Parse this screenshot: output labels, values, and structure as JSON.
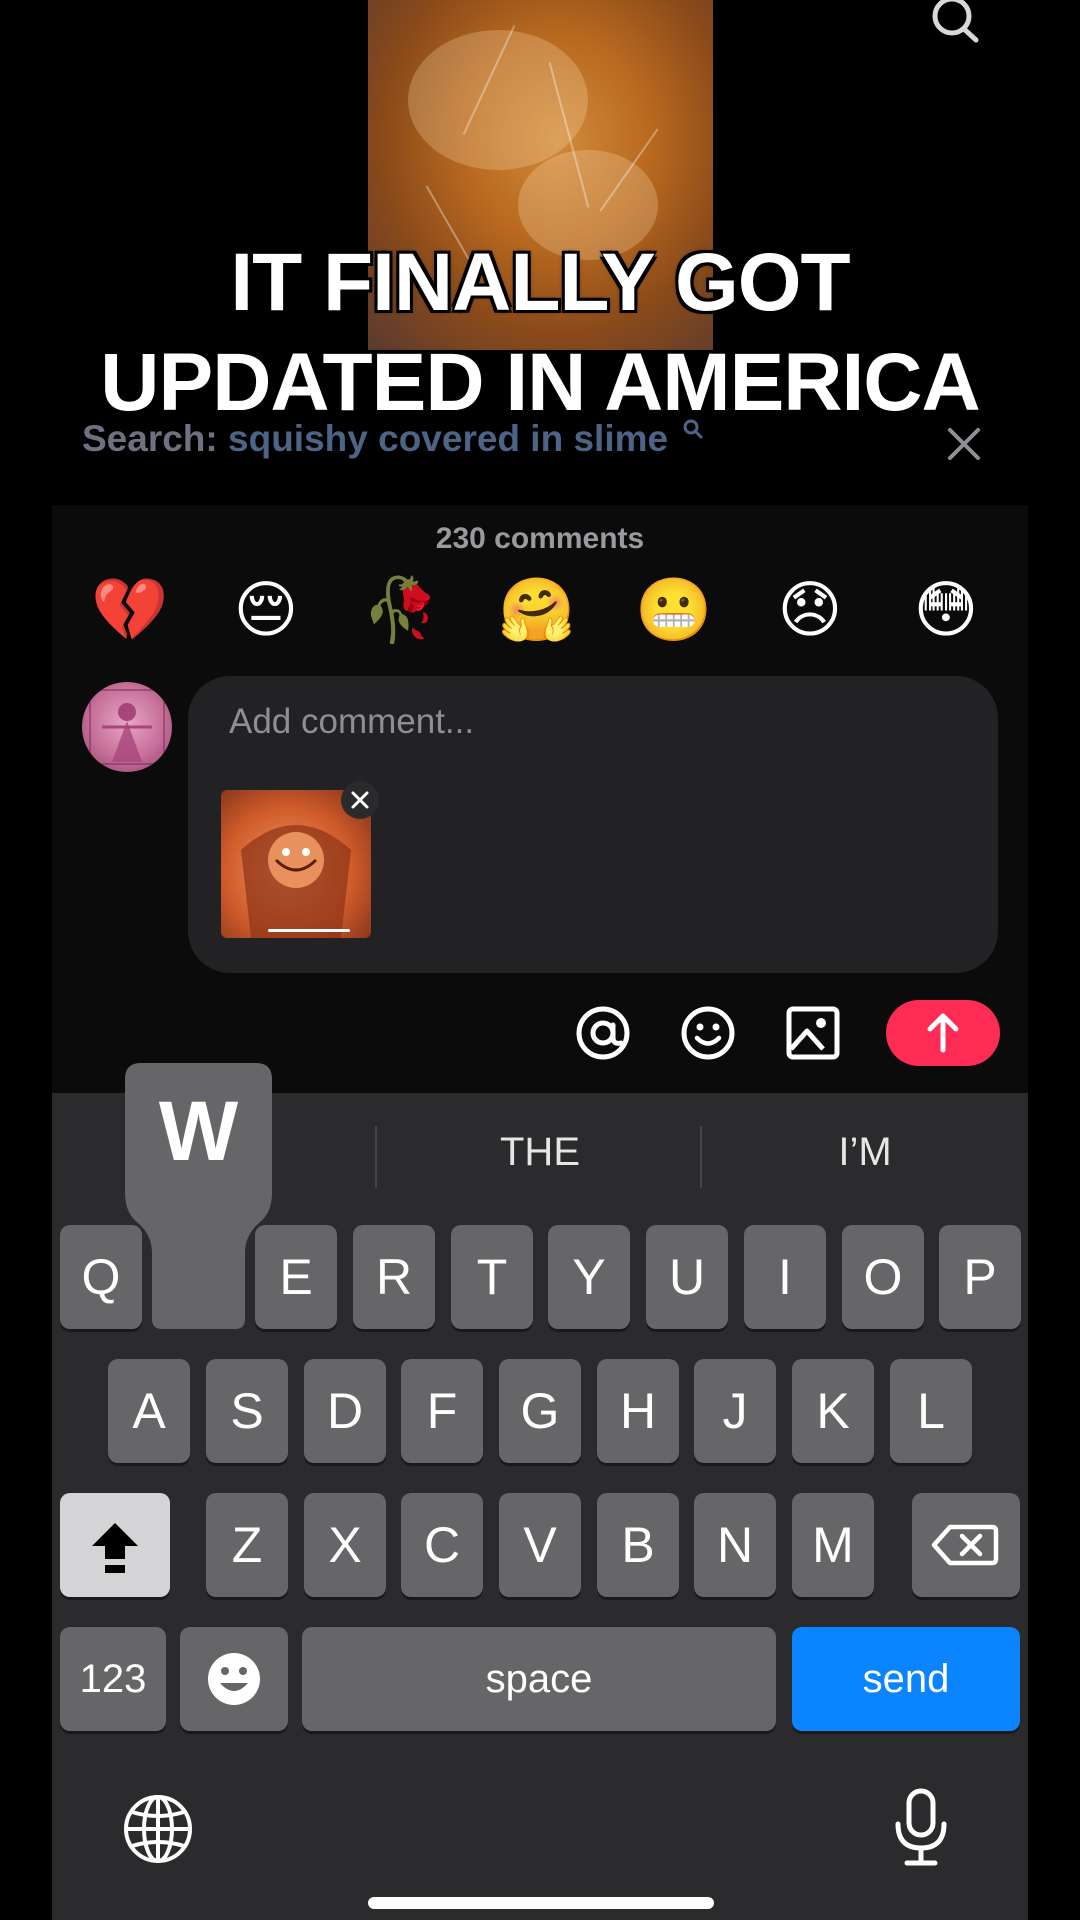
{
  "video": {
    "caption_line1": "IT FINALLY GOT",
    "caption_line2": "UPDATED IN AMERICA"
  },
  "search": {
    "prefix": "Search:",
    "query": "squishy covered in slime"
  },
  "comments": {
    "count_label": "230 comments",
    "quick_emojis": [
      "💔",
      "😔",
      "🥀",
      "🤗",
      "😬",
      "😞",
      "😳"
    ],
    "input_placeholder": "Add comment..."
  },
  "keyboard": {
    "popup_key": "W",
    "suggestions": [
      "THE",
      "I’M"
    ],
    "row1": [
      "Q",
      "W",
      "E",
      "R",
      "T",
      "Y",
      "U",
      "I",
      "O",
      "P"
    ],
    "row2": [
      "A",
      "S",
      "D",
      "F",
      "G",
      "H",
      "J",
      "K",
      "L"
    ],
    "row3": [
      "Z",
      "X",
      "C",
      "V",
      "B",
      "N",
      "M"
    ],
    "numbers_key": "123",
    "space_key": "space",
    "send_key": "send"
  },
  "colors": {
    "accent_red": "#fe2c55",
    "send_blue": "#0a84ff",
    "search_query": "#4d6487"
  },
  "icons": [
    "search-icon",
    "close-icon",
    "at-icon",
    "emoji-icon",
    "image-icon",
    "arrow-up-icon",
    "shift-icon",
    "backspace-icon",
    "emoji-key-icon",
    "globe-icon",
    "microphone-icon"
  ]
}
